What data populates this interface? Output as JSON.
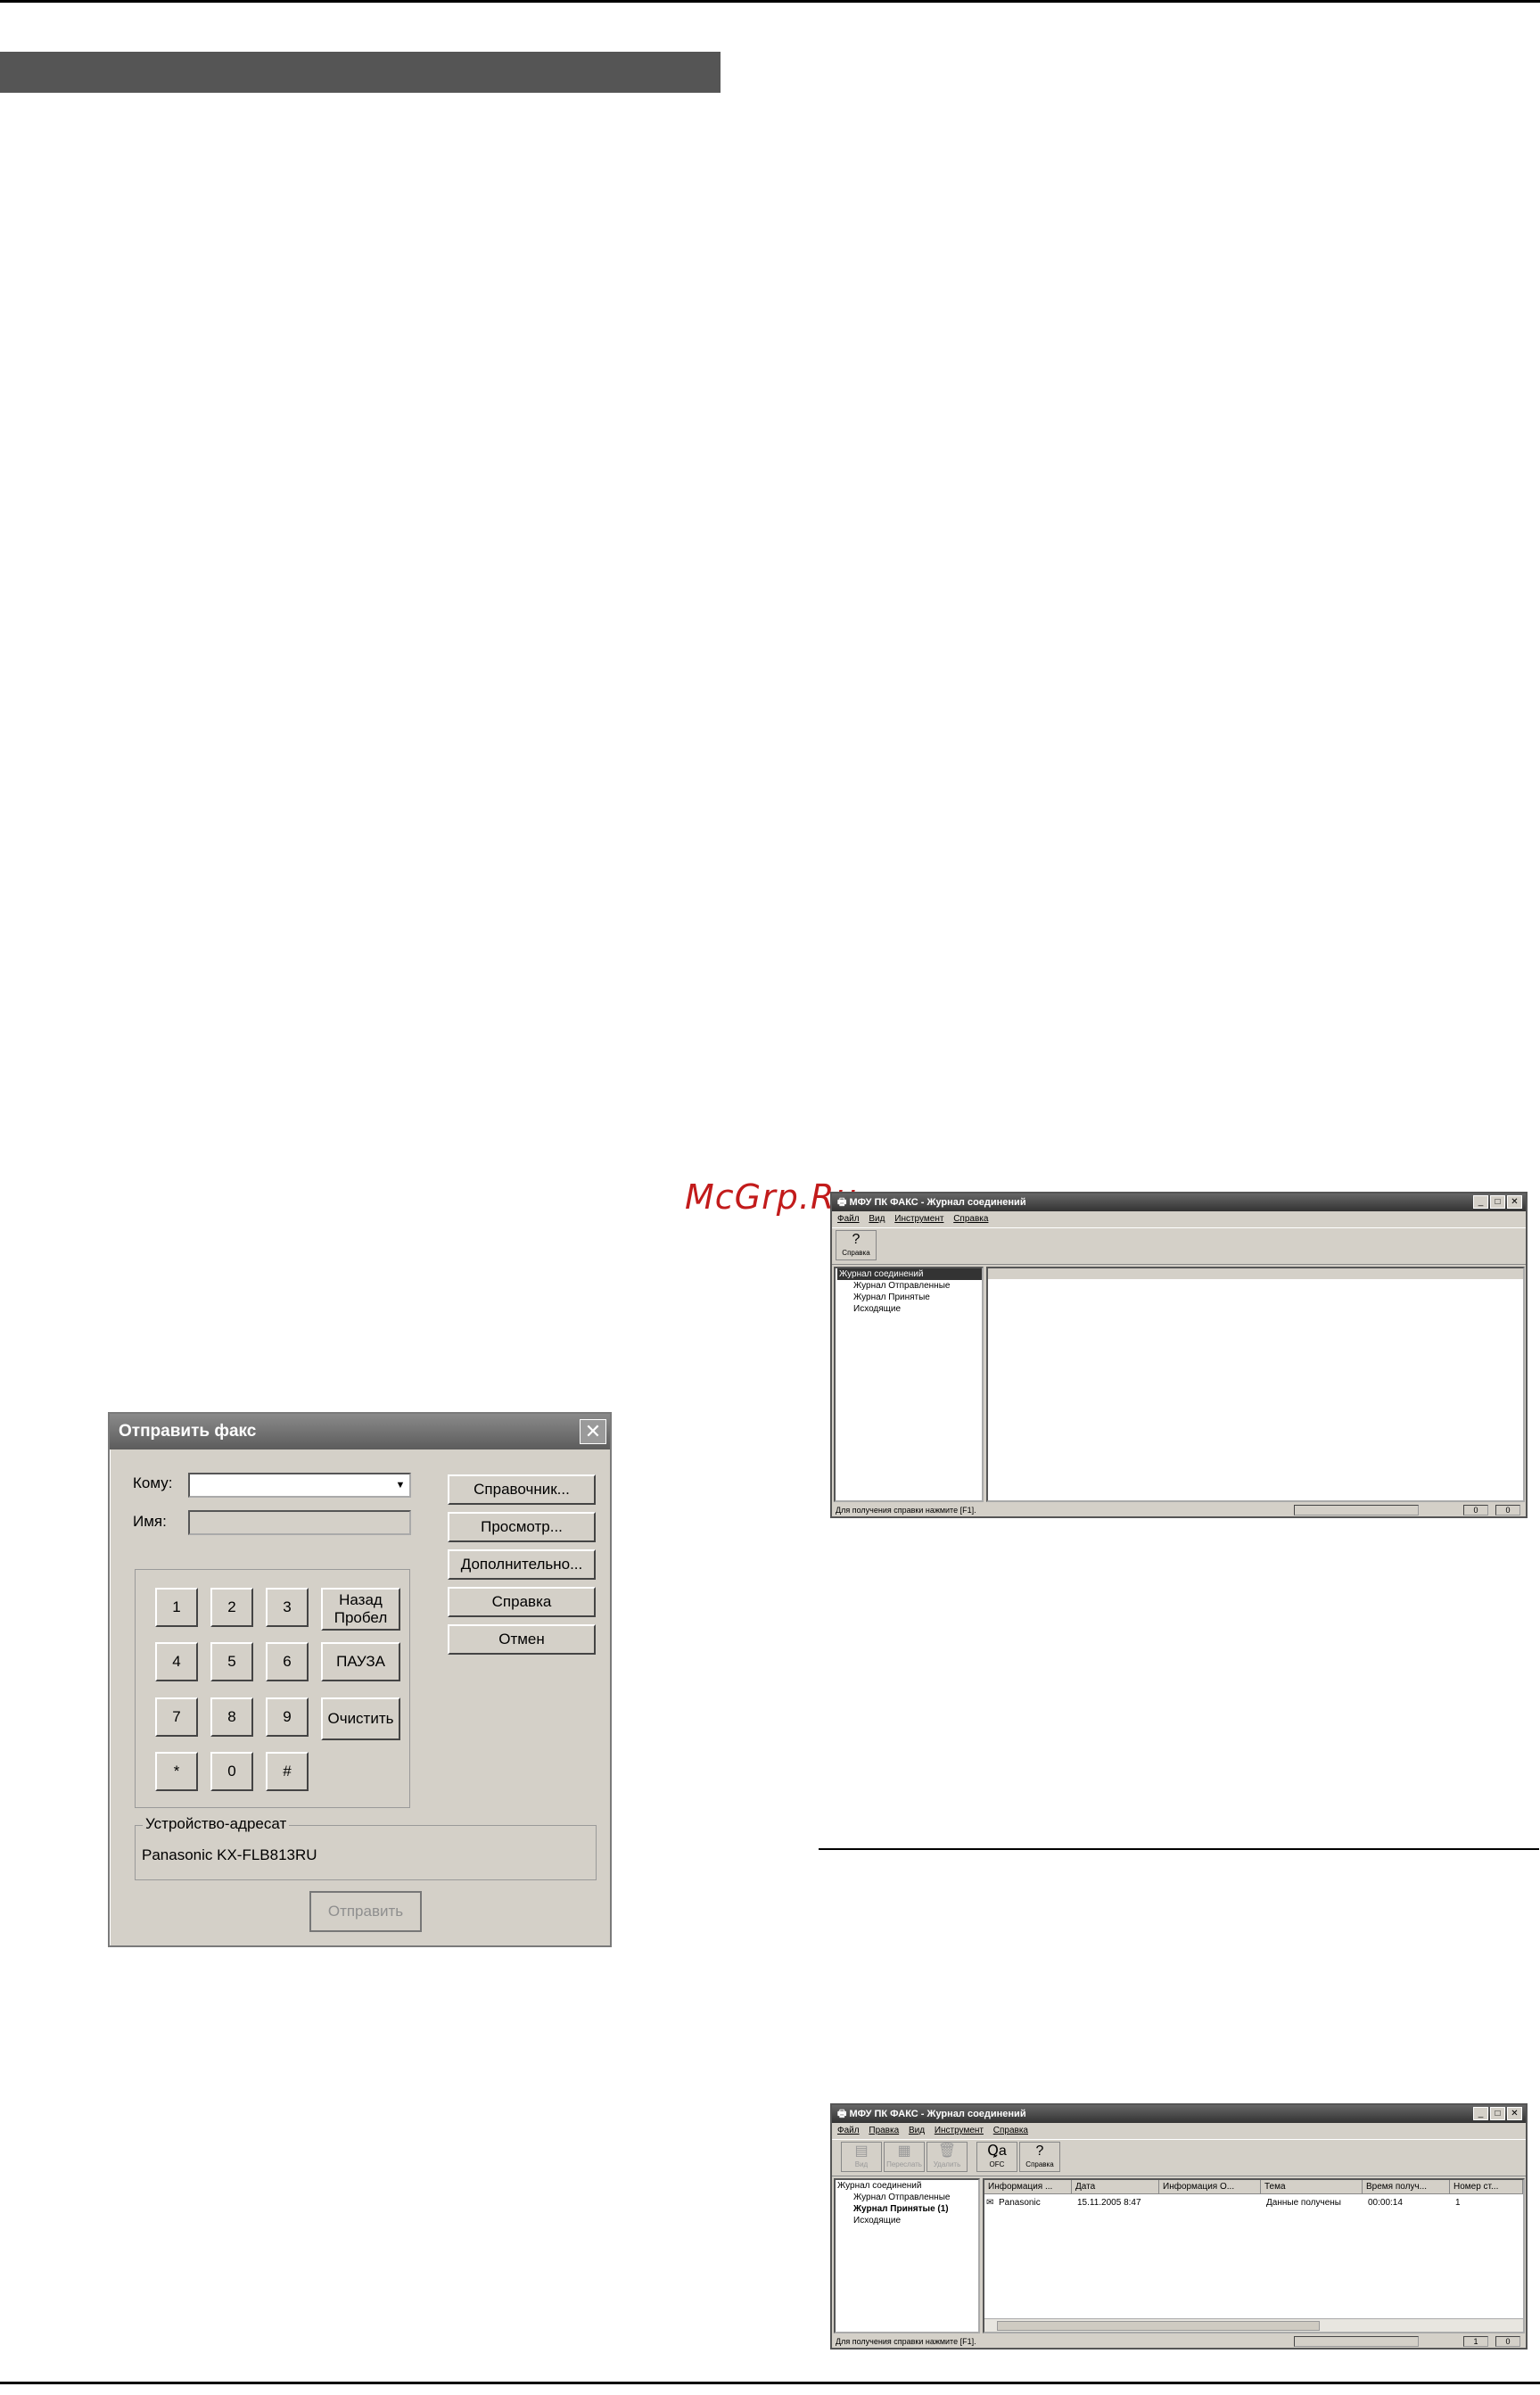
{
  "watermark": "McGrp.Ru",
  "send_fax_dialog": {
    "title": "Отправить факс",
    "to_label": "Кому:",
    "name_label": "Имя:",
    "keypad": {
      "digits": [
        "1",
        "2",
        "3",
        "4",
        "5",
        "6",
        "7",
        "8",
        "9",
        "*",
        "0",
        "#"
      ],
      "backspace_line1": "Назад",
      "backspace_line2": "Пробел",
      "pause": "ПАУЗА",
      "clear": "Очистить"
    },
    "buttons": {
      "directory": "Справочник...",
      "preview": "Просмотр...",
      "advanced": "Дополнительно...",
      "help": "Справка",
      "cancel": "Отмен",
      "send": "Отправить"
    },
    "device_group_label": "Устройство-адресат",
    "device_name": "Panasonic KX-FLB813RU"
  },
  "log_window_1": {
    "title": "МФУ ПК ФАКС - Журнал соединений",
    "menu": [
      "Файл",
      "Вид",
      "Инструмент",
      "Справка"
    ],
    "toolbar": {
      "help": "Справка"
    },
    "tree": {
      "root": "Журнал соединений",
      "children": [
        "Журнал Отправленные",
        "Журнал Принятые",
        "Исходящие"
      ]
    },
    "status": "Для получения справки нажмите [F1].",
    "status_counts": [
      "0",
      "0"
    ]
  },
  "log_window_2": {
    "title": "МФУ ПК ФАКС - Журнал соединений",
    "menu": [
      "Файл",
      "Правка",
      "Вид",
      "Инструмент",
      "Справка"
    ],
    "toolbar": {
      "view": "Вид",
      "resend": "Переслать",
      "delete": "Удалить",
      "ocr": "OFC",
      "help": "Справка"
    },
    "tree": {
      "root": "Журнал соединений",
      "children": [
        "Журнал Отправленные",
        "Журнал Принятые (1)",
        "Исходящие"
      ]
    },
    "columns": [
      "Информация ...",
      "Дата",
      "Информация О...",
      "Тема",
      "Время получ...",
      "Номер ст..."
    ],
    "row": [
      "Panasonic",
      "15.11.2005 8:47",
      "",
      "Данные получены",
      "00:00:14",
      "1"
    ],
    "status": "Для получения справки нажмите [F1].",
    "status_counts": [
      "1",
      "0"
    ]
  }
}
